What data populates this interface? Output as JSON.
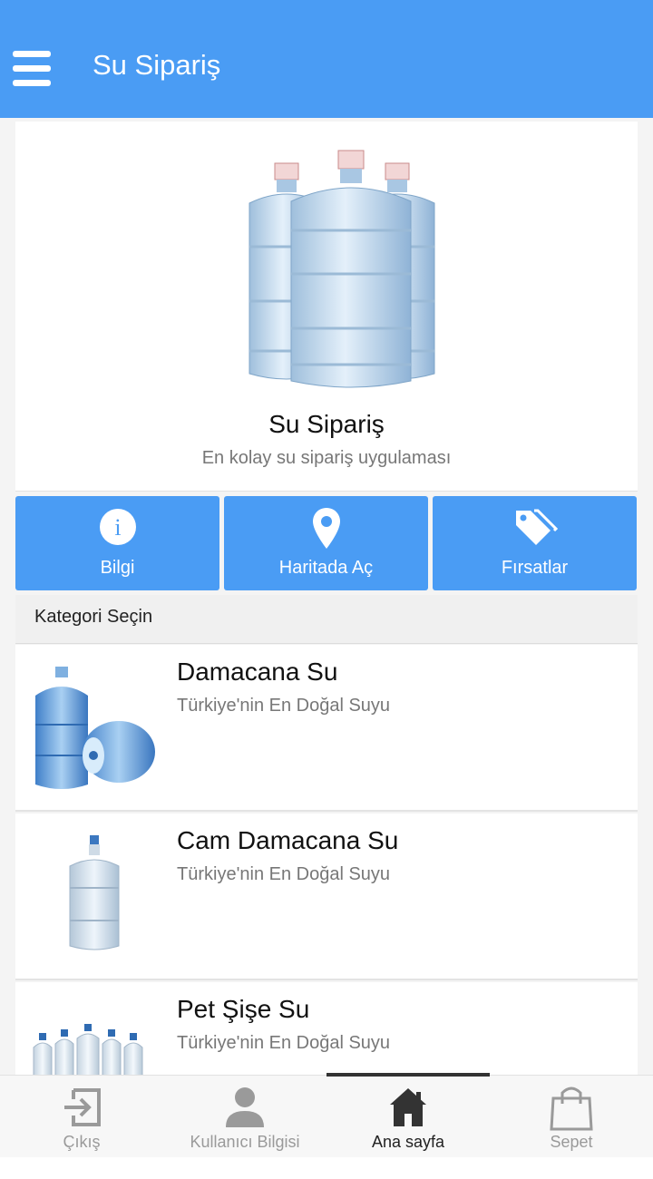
{
  "appbar": {
    "title": "Su Sipariş",
    "menu_icon": "hamburger-menu-icon"
  },
  "hero": {
    "title": "Su Sipariş",
    "subtitle": "En kolay su sipariş uygulaması"
  },
  "actions": [
    {
      "label": "Bilgi",
      "icon": "info-icon"
    },
    {
      "label": "Haritada Aç",
      "icon": "map-pin-icon"
    },
    {
      "label": "Fırsatlar",
      "icon": "tags-icon"
    }
  ],
  "category_header": "Kategori Seçin",
  "categories": [
    {
      "name": "Damacana Su",
      "desc": "Türkiye'nin En Doğal Suyu"
    },
    {
      "name": "Cam Damacana Su",
      "desc": "Türkiye'nin En Doğal Suyu"
    },
    {
      "name": "Pet Şişe Su",
      "desc": "Türkiye'nin En Doğal Suyu"
    }
  ],
  "bottom_nav": [
    {
      "label": "Çıkış",
      "icon": "logout-icon"
    },
    {
      "label": "Kullanıcı Bilgisi",
      "icon": "user-icon"
    },
    {
      "label": "Ana sayfa",
      "icon": "home-icon",
      "active": true
    },
    {
      "label": "Sepet",
      "icon": "shopping-bag-icon"
    }
  ],
  "colors": {
    "primary": "#4a9cf4",
    "active_nav": "#333333",
    "inactive_nav": "#9a9a9a"
  }
}
